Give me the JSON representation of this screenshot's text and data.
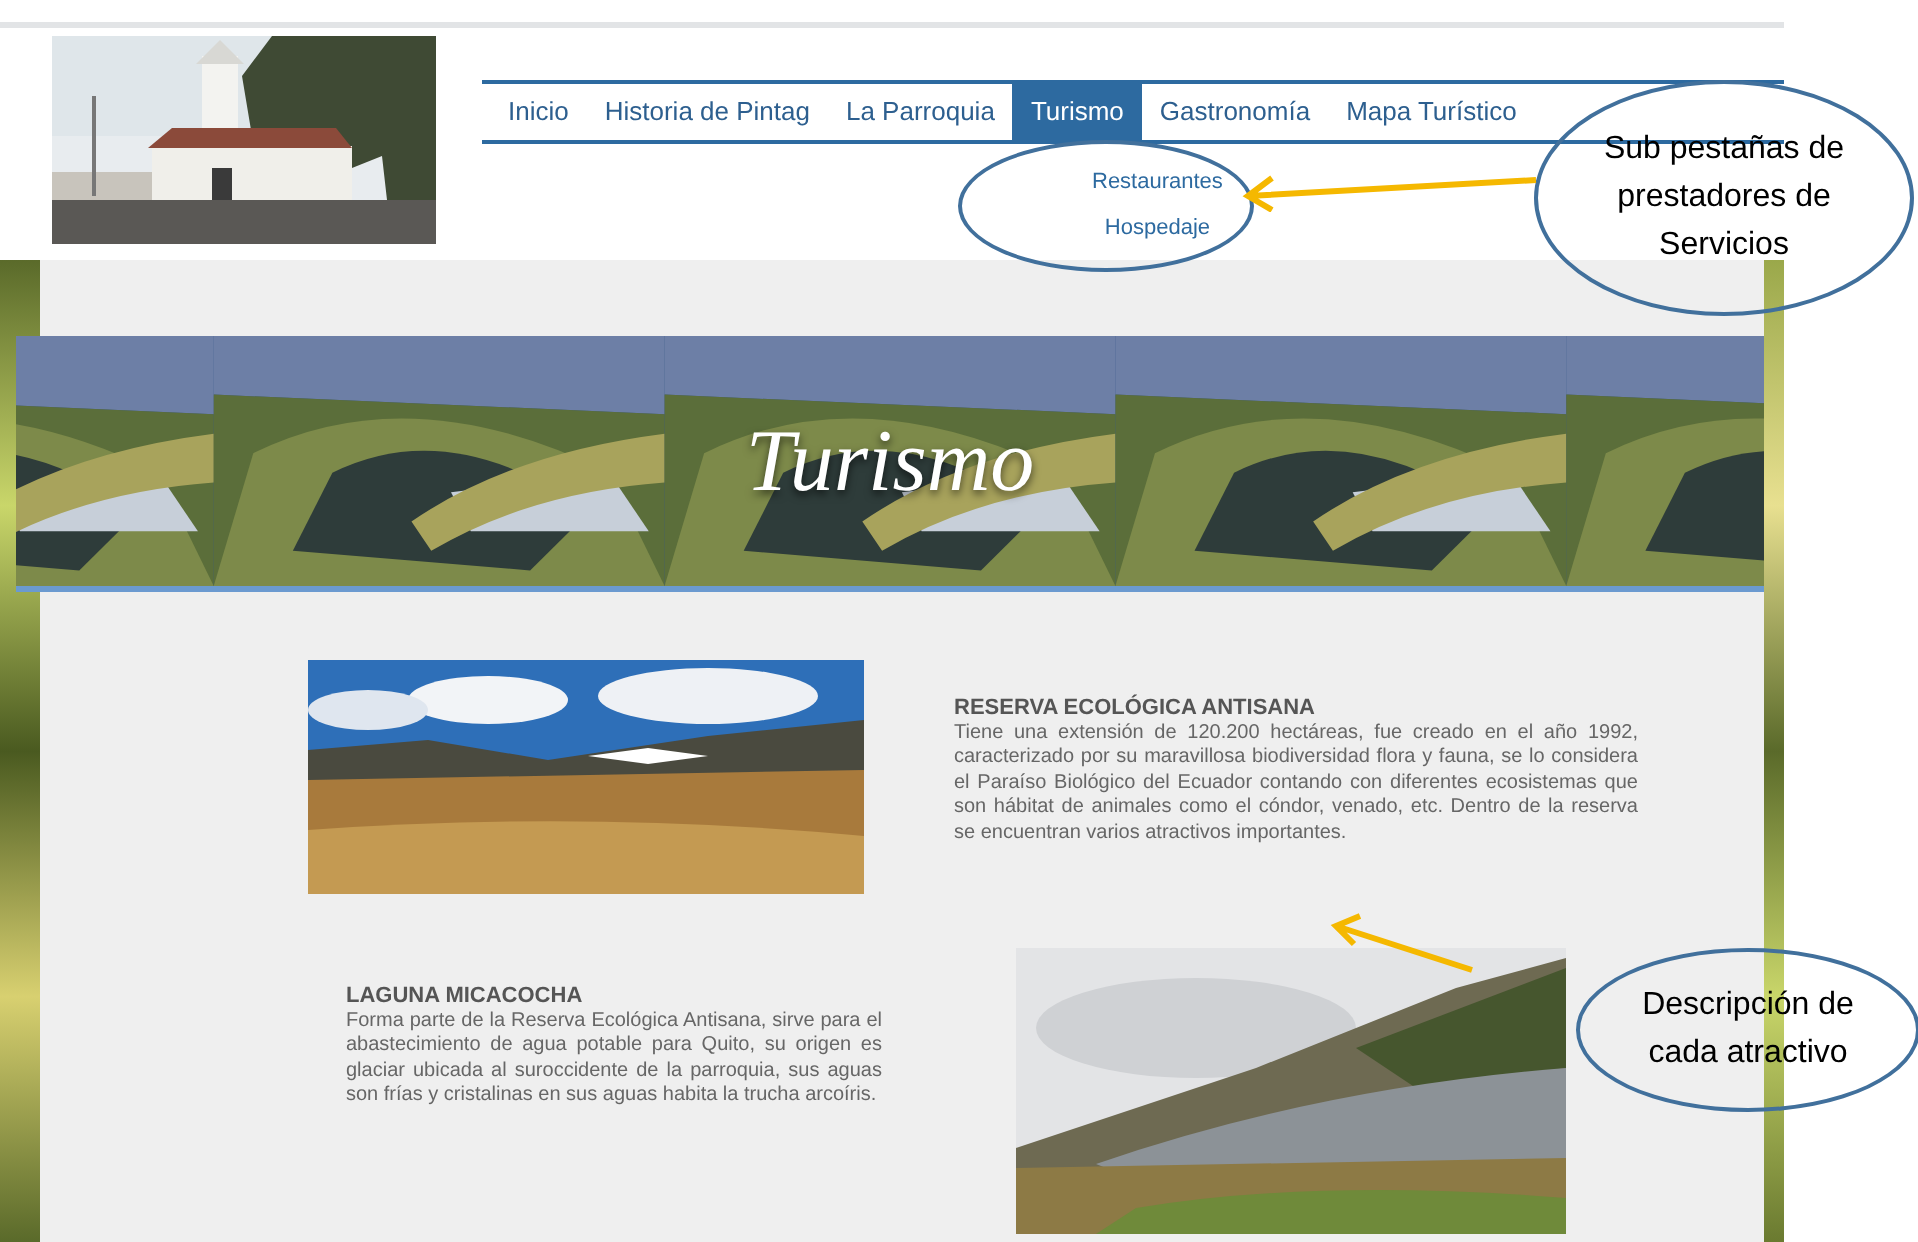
{
  "nav": {
    "tabs": [
      {
        "label": "Inicio",
        "selected": false
      },
      {
        "label": "Historia de Pintag",
        "selected": false
      },
      {
        "label": "La Parroquia",
        "selected": false
      },
      {
        "label": "Turismo",
        "selected": true
      },
      {
        "label": "Gastronomía",
        "selected": false
      },
      {
        "label": "Mapa Turístico",
        "selected": false
      }
    ],
    "submenu": [
      "Restaurantes",
      "Hospedaje"
    ]
  },
  "banner": {
    "title": "Turismo"
  },
  "attractions": [
    {
      "title": "RESERVA ECOLÓGICA ANTISANA",
      "description": "Tiene una extensión de 120.200 hectáreas, fue creado en el año 1992, caracterizado por su maravillosa biodiversidad flora y fauna, se lo considera el Paraíso Biológico del Ecuador contando con diferentes ecosistemas que son hábitat de animales como el cóndor, venado, etc. Dentro de la reserva se encuentran varios atractivos importantes."
    },
    {
      "title": "LAGUNA MICACOCHA",
      "description": "Forma parte de la Reserva Ecológica Antisana, sirve para el abastecimiento de agua potable para Quito, su origen es glaciar ubicada al suroccidente de la parroquia, sus aguas son frías y cristalinas en sus aguas habita la trucha arcoíris."
    }
  ],
  "annotations": [
    "Sub pestañas de prestadores de Servicios",
    "Descripción de cada atractivo"
  ]
}
